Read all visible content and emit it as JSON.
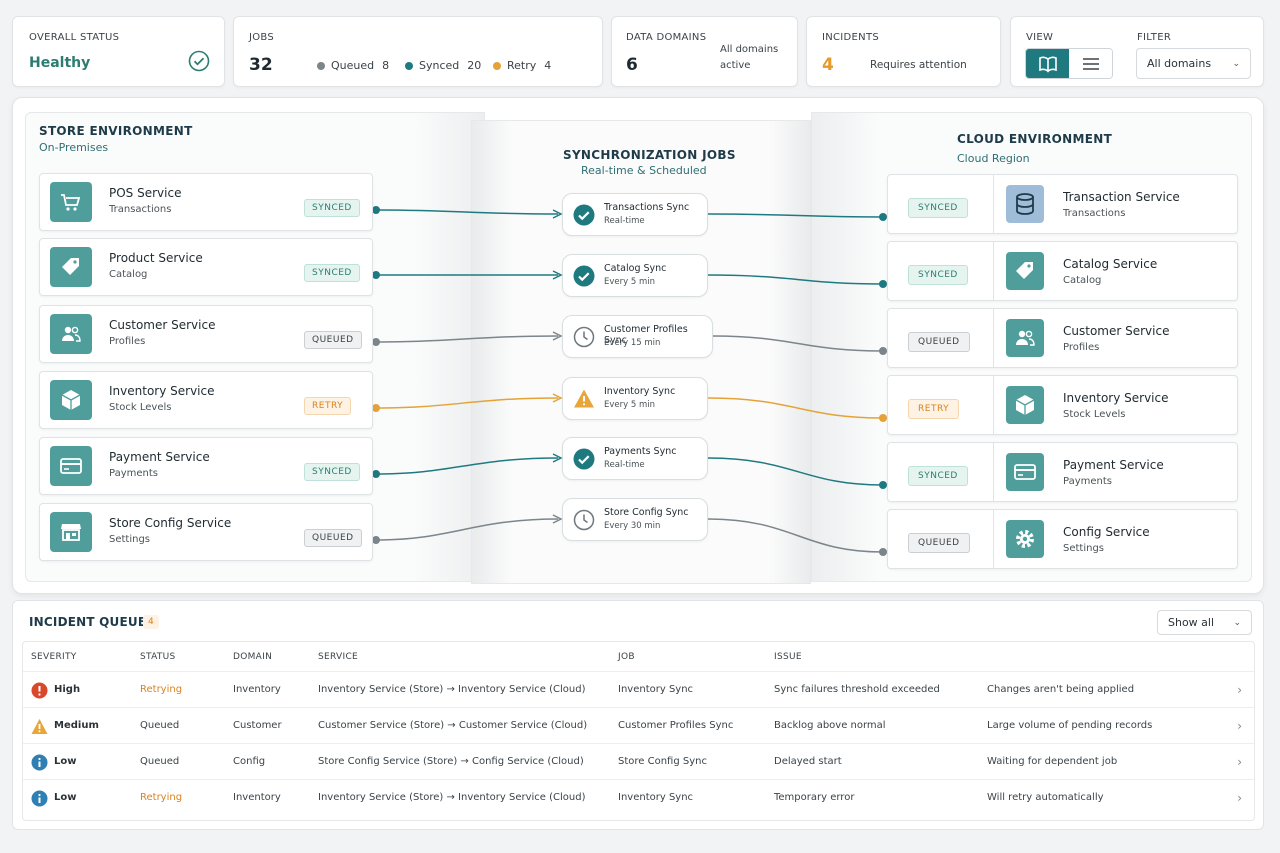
{
  "status": {
    "label": "OVERALL STATUS",
    "value": "Healthy",
    "color": "#2c7d70"
  },
  "jobs": {
    "label": "JOBS",
    "total": "32",
    "queued_label": "Queued",
    "queued": "8",
    "synced_label": "Synced",
    "synced": "20",
    "retry_label": "Retry",
    "retry": "4"
  },
  "domains": {
    "label": "DATA DOMAINS",
    "value": "6",
    "note_line1": "All domains",
    "note_line2": "active"
  },
  "incidents_card": {
    "label": "INCIDENTS",
    "value": "4",
    "note": "Requires attention",
    "color": "#e59a2b"
  },
  "view": {
    "label": "VIEW",
    "filter_label": "FILTER",
    "filter_value": "All domains",
    "active": "book-icon"
  },
  "colors": {
    "teal": "#1f7a80",
    "gray": "#7b858a",
    "orange": "#e5a236",
    "icon_bg": "#4f9e9b"
  },
  "store": {
    "title": "STORE ENVIRONMENT",
    "subtitle": "On-Premises",
    "services": [
      {
        "name": "POS Service",
        "sub": "Transactions",
        "status": "SYNCED",
        "icon": "cart-icon"
      },
      {
        "name": "Product Service",
        "sub": "Catalog",
        "status": "SYNCED",
        "icon": "tag-icon"
      },
      {
        "name": "Customer Service",
        "sub": "Profiles",
        "status": "QUEUED",
        "icon": "users-icon"
      },
      {
        "name": "Inventory Service",
        "sub": "Stock Levels",
        "status": "RETRY",
        "icon": "box-icon"
      },
      {
        "name": "Payment Service",
        "sub": "Payments",
        "status": "SYNCED",
        "icon": "card-icon"
      },
      {
        "name": "Store Config Service",
        "sub": "Settings",
        "status": "QUEUED",
        "icon": "store-icon"
      }
    ]
  },
  "sync": {
    "title": "SYNCHRONIZATION JOBS",
    "subtitle": "Real-time & Scheduled",
    "jobs": [
      {
        "name": "Transactions Sync",
        "sub": "Real-time",
        "icon": "check-icon"
      },
      {
        "name": "Catalog Sync",
        "sub": "Every 5 min",
        "icon": "check-icon"
      },
      {
        "name": "Customer Profiles Sync",
        "sub": "Every 15 min",
        "icon": "clock-icon"
      },
      {
        "name": "Inventory Sync",
        "sub": "Every 5 min",
        "icon": "warning-icon"
      },
      {
        "name": "Payments Sync",
        "sub": "Real-time",
        "icon": "check-icon"
      },
      {
        "name": "Store Config Sync",
        "sub": "Every 30 min",
        "icon": "clock-icon"
      }
    ]
  },
  "cloud": {
    "title": "CLOUD ENVIRONMENT",
    "subtitle": "Cloud Region",
    "services": [
      {
        "name": "Transaction Service",
        "sub": "Transactions",
        "status": "SYNCED",
        "icon": "database-icon"
      },
      {
        "name": "Catalog Service",
        "sub": "Catalog",
        "status": "SYNCED",
        "icon": "tag-icon"
      },
      {
        "name": "Customer Service",
        "sub": "Profiles",
        "status": "QUEUED",
        "icon": "users-icon"
      },
      {
        "name": "Inventory Service",
        "sub": "Stock Levels",
        "status": "RETRY",
        "icon": "box-icon"
      },
      {
        "name": "Payment Service",
        "sub": "Payments",
        "status": "SYNCED",
        "icon": "card-icon"
      },
      {
        "name": "Config Service",
        "sub": "Settings",
        "status": "QUEUED",
        "icon": "gear-icon"
      }
    ]
  },
  "queue": {
    "title": "INCIDENT QUEUE",
    "count": "4",
    "show": "Show all",
    "headers": [
      "SEVERITY",
      "STATUS",
      "DOMAIN",
      "SERVICE",
      "JOB",
      "ISSUE"
    ],
    "rows": [
      {
        "severity": "High",
        "status": "Retrying",
        "domain": "Inventory",
        "service": "Inventory Service (Store) → Inventory Service (Cloud)",
        "job": "Inventory Sync",
        "issue": "Sync failures threshold exceeded",
        "detail": "Changes aren't being applied",
        "icon": "error-icon"
      },
      {
        "severity": "Medium",
        "status": "Queued",
        "domain": "Customer",
        "service": "Customer Service (Store) → Customer Service (Cloud)",
        "job": "Customer Profiles Sync",
        "issue": "Backlog above normal",
        "detail": "Large volume of pending records",
        "icon": "warning-icon"
      },
      {
        "severity": "Low",
        "status": "Queued",
        "domain": "Config",
        "service": "Store Config Service (Store) → Config Service (Cloud)",
        "job": "Store Config Sync",
        "issue": "Delayed start",
        "detail": "Waiting for dependent job",
        "icon": "info-icon"
      },
      {
        "severity": "Low",
        "status": "Retrying",
        "domain": "Inventory",
        "service": "Inventory Service (Store) → Inventory Service (Cloud)",
        "job": "Inventory Sync",
        "issue": "Temporary error",
        "detail": "Will retry automatically",
        "icon": "info-icon"
      }
    ]
  }
}
